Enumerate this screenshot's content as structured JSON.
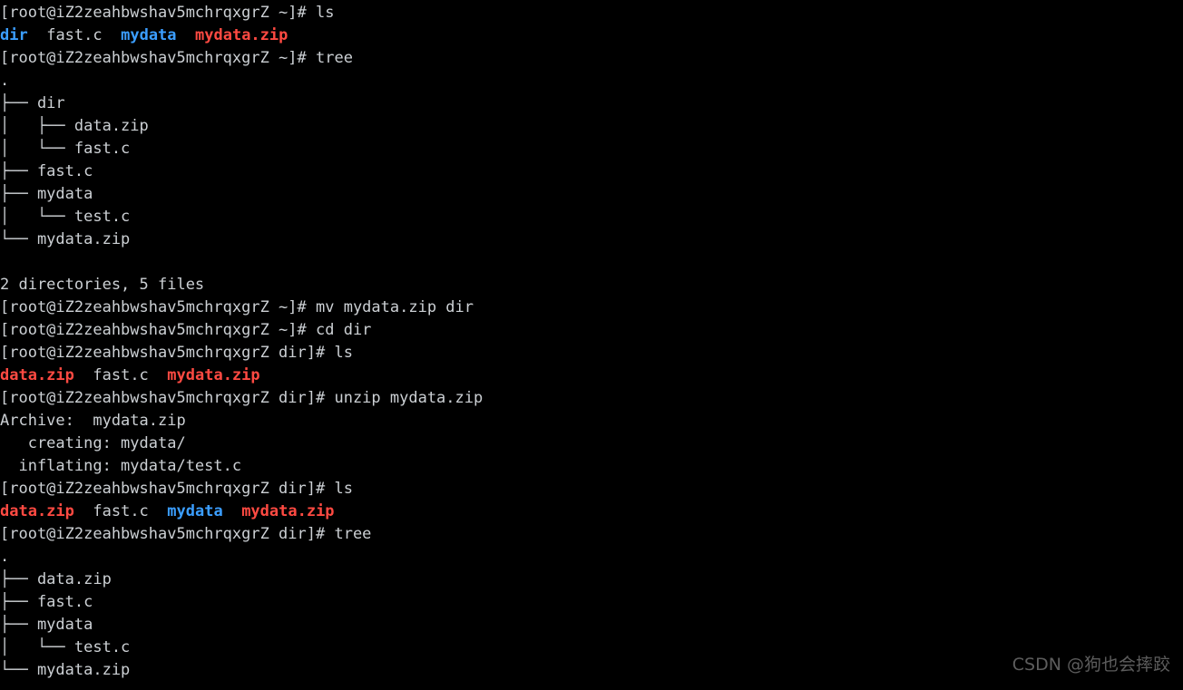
{
  "terminal": {
    "background_color": "#000000",
    "foreground_color": "#ccd0d4",
    "dir_color": "#3b9eff",
    "archive_color": "#ff4a42",
    "prompt_home": "[root@iZ2zeahbwshav5mchrqxgrZ ~]# ",
    "prompt_dir": "[root@iZ2zeahbwshav5mchrqxgrZ dir]# ",
    "lines": [
      {
        "id": "l01",
        "segments": [
          {
            "text": "[root@iZ2zeahbwshav5mchrqxgrZ ~]# ",
            "color": "default"
          },
          {
            "text": "ls",
            "color": "default"
          }
        ]
      },
      {
        "id": "l02",
        "segments": [
          {
            "text": "dir",
            "color": "dir"
          },
          {
            "text": "  ",
            "color": "default"
          },
          {
            "text": "fast.c",
            "color": "default"
          },
          {
            "text": "  ",
            "color": "default"
          },
          {
            "text": "mydata",
            "color": "dir"
          },
          {
            "text": "  ",
            "color": "default"
          },
          {
            "text": "mydata.zip",
            "color": "archive"
          }
        ]
      },
      {
        "id": "l03",
        "segments": [
          {
            "text": "[root@iZ2zeahbwshav5mchrqxgrZ ~]# ",
            "color": "default"
          },
          {
            "text": "tree",
            "color": "default"
          }
        ]
      },
      {
        "id": "l04",
        "segments": [
          {
            "text": ".",
            "color": "default"
          }
        ]
      },
      {
        "id": "l05",
        "segments": [
          {
            "text": "├── dir",
            "color": "default"
          }
        ]
      },
      {
        "id": "l06",
        "segments": [
          {
            "text": "│   ├── data.zip",
            "color": "default"
          }
        ]
      },
      {
        "id": "l07",
        "segments": [
          {
            "text": "│   └── fast.c",
            "color": "default"
          }
        ]
      },
      {
        "id": "l08",
        "segments": [
          {
            "text": "├── fast.c",
            "color": "default"
          }
        ]
      },
      {
        "id": "l09",
        "segments": [
          {
            "text": "├── mydata",
            "color": "default"
          }
        ]
      },
      {
        "id": "l10",
        "segments": [
          {
            "text": "│   └── test.c",
            "color": "default"
          }
        ]
      },
      {
        "id": "l11",
        "segments": [
          {
            "text": "└── mydata.zip",
            "color": "default"
          }
        ]
      },
      {
        "id": "l12",
        "segments": [
          {
            "text": "",
            "color": "default"
          }
        ]
      },
      {
        "id": "l13",
        "segments": [
          {
            "text": "2 directories, 5 files",
            "color": "default"
          }
        ]
      },
      {
        "id": "l14",
        "segments": [
          {
            "text": "[root@iZ2zeahbwshav5mchrqxgrZ ~]# ",
            "color": "default"
          },
          {
            "text": "mv mydata.zip dir",
            "color": "default"
          }
        ]
      },
      {
        "id": "l15",
        "segments": [
          {
            "text": "[root@iZ2zeahbwshav5mchrqxgrZ ~]# ",
            "color": "default"
          },
          {
            "text": "cd dir",
            "color": "default"
          }
        ]
      },
      {
        "id": "l16",
        "segments": [
          {
            "text": "[root@iZ2zeahbwshav5mchrqxgrZ dir]# ",
            "color": "default"
          },
          {
            "text": "ls",
            "color": "default"
          }
        ]
      },
      {
        "id": "l17",
        "segments": [
          {
            "text": "data.zip",
            "color": "archive"
          },
          {
            "text": "  ",
            "color": "default"
          },
          {
            "text": "fast.c",
            "color": "default"
          },
          {
            "text": "  ",
            "color": "default"
          },
          {
            "text": "mydata.zip",
            "color": "archive"
          }
        ]
      },
      {
        "id": "l18",
        "segments": [
          {
            "text": "[root@iZ2zeahbwshav5mchrqxgrZ dir]# ",
            "color": "default"
          },
          {
            "text": "unzip mydata.zip",
            "color": "default"
          }
        ]
      },
      {
        "id": "l19",
        "segments": [
          {
            "text": "Archive:  mydata.zip",
            "color": "default"
          }
        ]
      },
      {
        "id": "l20",
        "segments": [
          {
            "text": "   creating: mydata/",
            "color": "default"
          }
        ]
      },
      {
        "id": "l21",
        "segments": [
          {
            "text": "  inflating: mydata/test.c",
            "color": "default"
          }
        ]
      },
      {
        "id": "l22",
        "segments": [
          {
            "text": "[root@iZ2zeahbwshav5mchrqxgrZ dir]# ",
            "color": "default"
          },
          {
            "text": "ls",
            "color": "default"
          }
        ]
      },
      {
        "id": "l23",
        "segments": [
          {
            "text": "data.zip",
            "color": "archive"
          },
          {
            "text": "  ",
            "color": "default"
          },
          {
            "text": "fast.c",
            "color": "default"
          },
          {
            "text": "  ",
            "color": "default"
          },
          {
            "text": "mydata",
            "color": "dir"
          },
          {
            "text": "  ",
            "color": "default"
          },
          {
            "text": "mydata.zip",
            "color": "archive"
          }
        ]
      },
      {
        "id": "l24",
        "segments": [
          {
            "text": "[root@iZ2zeahbwshav5mchrqxgrZ dir]# ",
            "color": "default"
          },
          {
            "text": "tree",
            "color": "default"
          }
        ]
      },
      {
        "id": "l25",
        "segments": [
          {
            "text": ".",
            "color": "default"
          }
        ]
      },
      {
        "id": "l26",
        "segments": [
          {
            "text": "├── data.zip",
            "color": "default"
          }
        ]
      },
      {
        "id": "l27",
        "segments": [
          {
            "text": "├── fast.c",
            "color": "default"
          }
        ]
      },
      {
        "id": "l28",
        "segments": [
          {
            "text": "├── mydata",
            "color": "default"
          }
        ]
      },
      {
        "id": "l29",
        "segments": [
          {
            "text": "│   └── test.c",
            "color": "default"
          }
        ]
      },
      {
        "id": "l30",
        "segments": [
          {
            "text": "└── mydata.zip",
            "color": "default"
          }
        ]
      }
    ]
  },
  "watermark": {
    "text": "CSDN @狗也会摔跤"
  }
}
